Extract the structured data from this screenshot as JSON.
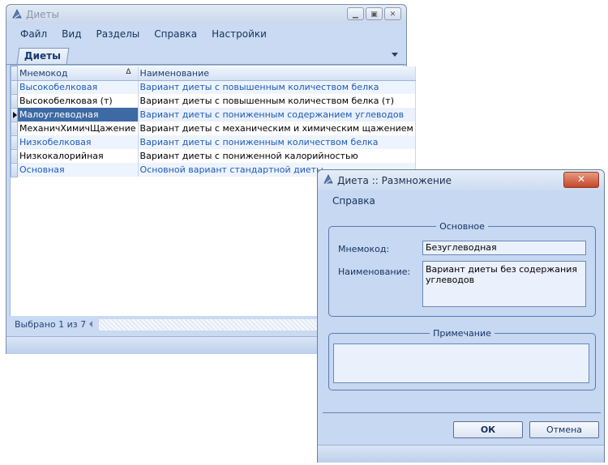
{
  "main_window": {
    "title": "Диеты",
    "menu": [
      "Файл",
      "Вид",
      "Разделы",
      "Справка",
      "Настройки"
    ],
    "tab": "Диеты",
    "grid": {
      "columns": [
        "Мнемокод",
        "Наименование"
      ],
      "sort_indicator": "Δ",
      "rows": [
        {
          "code": "Высокобелковая",
          "name": "Вариант диеты с повышенным количеством белка"
        },
        {
          "code": "Высокобелковая (т)",
          "name": "Вариант диеты с повышенным количеством белка (т)"
        },
        {
          "code": "Малоуглеводная",
          "name": "Вариант диеты с пониженным содержанием углеводов"
        },
        {
          "code": "МеханичХимичЩажение",
          "name": "Вариант диеты с механическим и химическим щажением"
        },
        {
          "code": "Низкобелковая",
          "name": "Вариант диеты с пониженным количеством белка"
        },
        {
          "code": "Низкокалорийная",
          "name": "Вариант диеты с пониженной калорийностью"
        },
        {
          "code": "Основная",
          "name": "Основной вариант стандартной диеты"
        }
      ]
    },
    "status": "Выбрано 1 из 7"
  },
  "dialog": {
    "title": "Диета :: Размножение",
    "menu": "Справка",
    "group_main": "Основное",
    "mnemocode_label": "Мнемокод:",
    "mnemocode_value": "Безуглеводная",
    "name_label": "Наименование:",
    "name_value": "Вариант диеты без содержания углеводов",
    "group_note": "Примечание",
    "note_value": "",
    "ok_label": "ОК",
    "cancel_label": "Отмена",
    "close_glyph": "✕"
  },
  "colors": {
    "accent": "#3d6aa4",
    "window_bg": "#c9daf2",
    "link_text": "#1d5bb5"
  }
}
